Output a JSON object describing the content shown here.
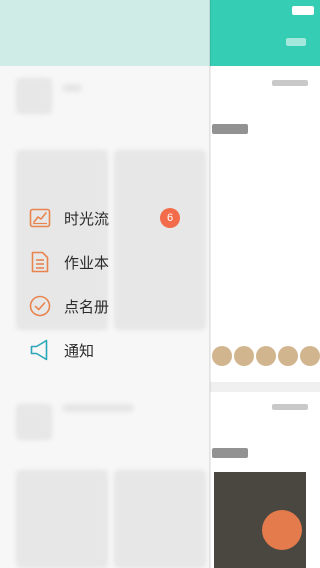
{
  "drawer": {
    "items": [
      {
        "label": "时光流",
        "icon": "chart-frame-icon",
        "badge": "6"
      },
      {
        "label": "作业本",
        "icon": "document-icon"
      },
      {
        "label": "点名册",
        "icon": "check-circle-icon"
      },
      {
        "label": "通知",
        "icon": "speaker-icon"
      }
    ]
  },
  "colors": {
    "header": "#35cdb4",
    "accent_orange": "#f26b4a",
    "icon_orange": "#e8854f",
    "icon_teal": "#2aa6b8",
    "drawer_bg": "#f6f6f6"
  }
}
